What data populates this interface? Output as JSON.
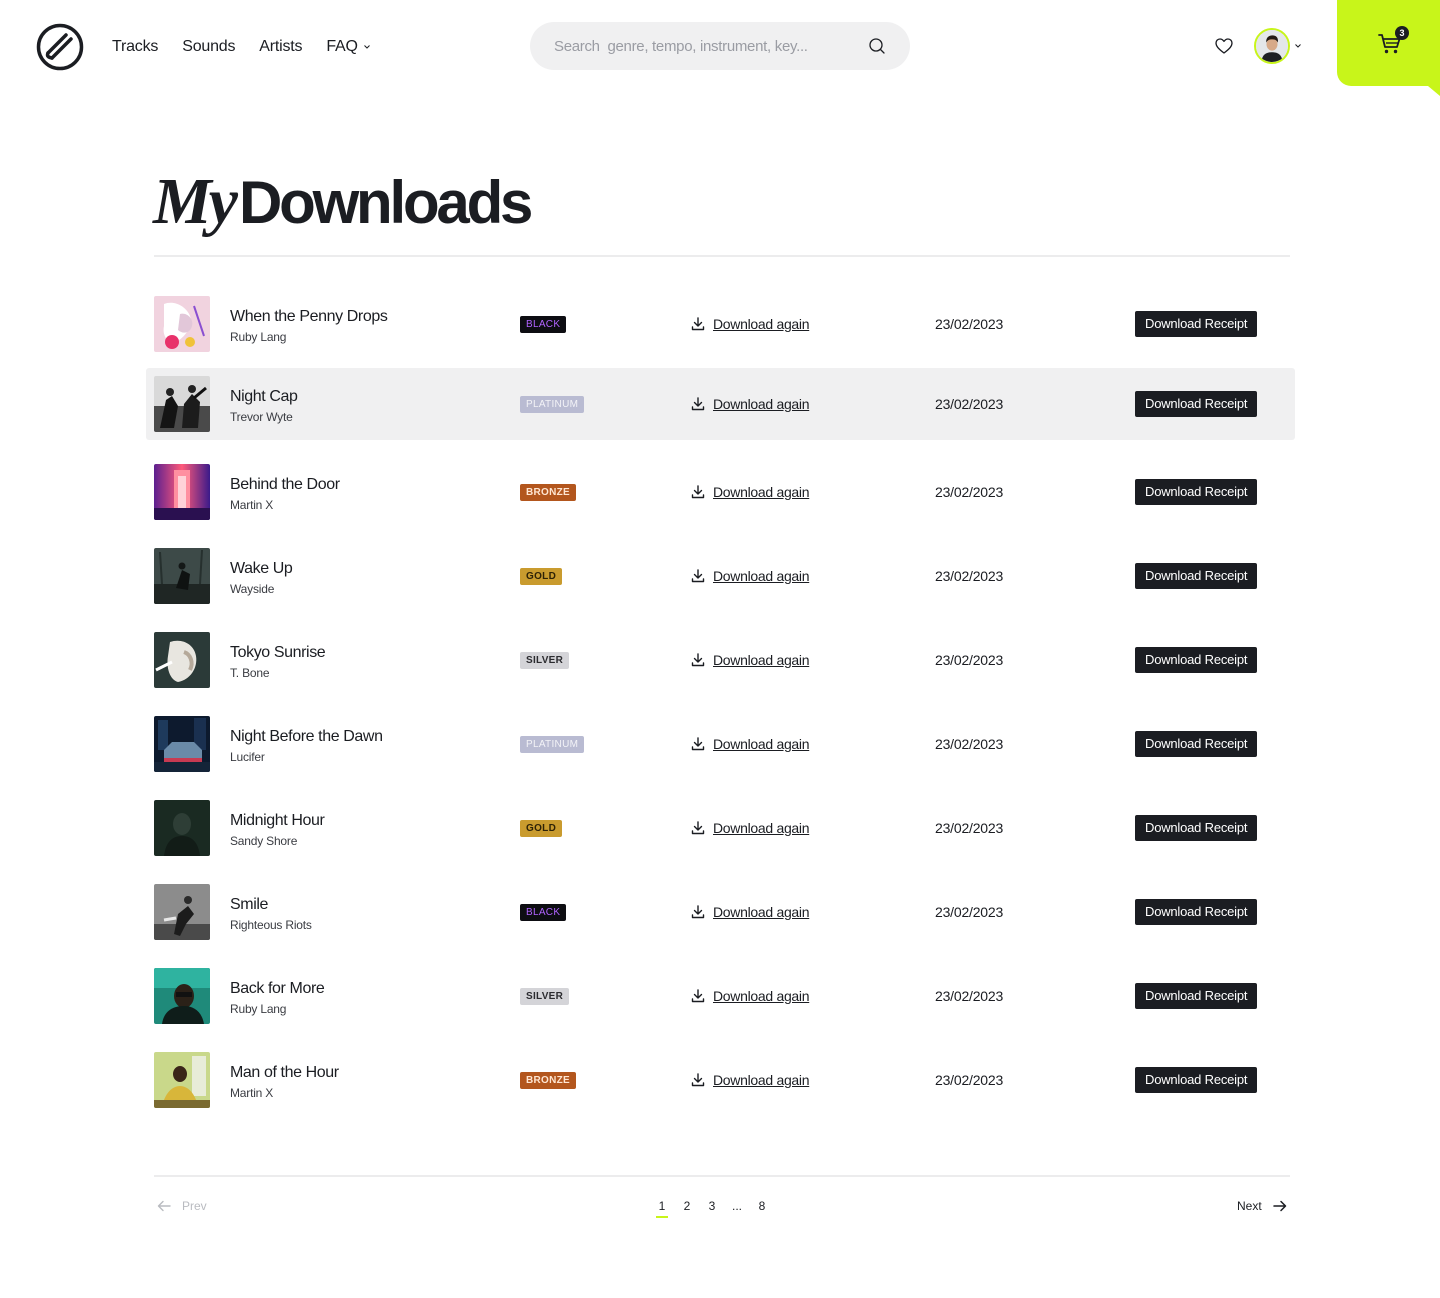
{
  "header": {
    "nav": [
      {
        "label": "Tracks"
      },
      {
        "label": "Sounds"
      },
      {
        "label": "Artists"
      },
      {
        "label": "FAQ"
      }
    ],
    "search_placeholder": "Search  genre, tempo, instrument, key...",
    "cart_count": "3",
    "accent_color": "#c8f51a"
  },
  "page": {
    "title_italic": "My",
    "title_bold": "Downloads"
  },
  "rows": [
    {
      "title": "When the Penny Drops",
      "artist": "Ruby Lang",
      "tier": "BLACK",
      "action": "Download again",
      "date": "23/02/2023",
      "receipt": "Download Receipt"
    },
    {
      "title": "Night Cap",
      "artist": "Trevor Wyte",
      "tier": "PLATINUM",
      "action": "Download again",
      "date": "23/02/2023",
      "receipt": "Download Receipt"
    },
    {
      "title": "Behind the Door",
      "artist": "Martin X",
      "tier": "BRONZE",
      "action": "Download again",
      "date": "23/02/2023",
      "receipt": "Download Receipt"
    },
    {
      "title": "Wake Up",
      "artist": "Wayside",
      "tier": "GOLD",
      "action": "Download again",
      "date": "23/02/2023",
      "receipt": "Download Receipt"
    },
    {
      "title": "Tokyo Sunrise",
      "artist": "T. Bone",
      "tier": "SILVER",
      "action": "Download again",
      "date": "23/02/2023",
      "receipt": "Download Receipt"
    },
    {
      "title": "Night Before the Dawn",
      "artist": "Lucifer",
      "tier": "PLATINUM",
      "action": "Download again",
      "date": "23/02/2023",
      "receipt": "Download Receipt"
    },
    {
      "title": "Midnight Hour",
      "artist": "Sandy Shore",
      "tier": "GOLD",
      "action": "Download again",
      "date": "23/02/2023",
      "receipt": "Download Receipt"
    },
    {
      "title": "Smile",
      "artist": "Righteous Riots",
      "tier": "BLACK",
      "action": "Download again",
      "date": "23/02/2023",
      "receipt": "Download Receipt"
    },
    {
      "title": "Back for More",
      "artist": "Ruby Lang",
      "tier": "SILVER",
      "action": "Download again",
      "date": "23/02/2023",
      "receipt": "Download Receipt"
    },
    {
      "title": "Man of the Hour",
      "artist": "Martin X",
      "tier": "BRONZE",
      "action": "Download again",
      "date": "23/02/2023",
      "receipt": "Download Receipt"
    }
  ],
  "pagination": {
    "prev": "Prev",
    "next": "Next",
    "pages": [
      "1",
      "2",
      "3",
      "...",
      "8"
    ],
    "current": "1"
  }
}
